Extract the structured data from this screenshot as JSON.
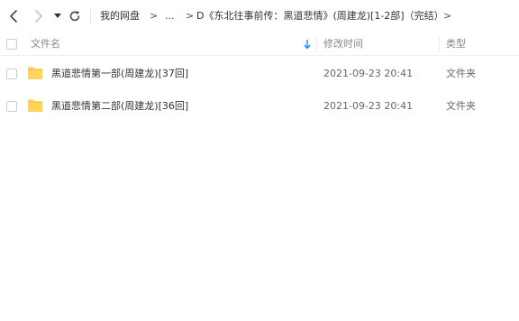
{
  "toolbar": {
    "back_icon": "chevron-left-icon",
    "forward_icon": "chevron-right-icon",
    "history_icon": "caret-down-icon",
    "refresh_icon": "refresh-icon"
  },
  "breadcrumb": {
    "home": "我的网盘",
    "separator": ">",
    "ellipsis": "...",
    "current": "D《东北往事前传：黑道悲情》(周建龙)[1-2部]（完结）"
  },
  "columns": {
    "name": "文件名",
    "date": "修改时间",
    "type": "类型",
    "sort_icon": "sort-down-arrow-icon",
    "sort_color": "#1a8cff"
  },
  "rows": [
    {
      "name": "黑道悲情第一部(周建龙)[37回]",
      "date": "2021-09-23 20:41",
      "type": "文件夹",
      "icon": "folder-icon"
    },
    {
      "name": "黑道悲情第二部(周建龙)[36回]",
      "date": "2021-09-23 20:41",
      "type": "文件夹",
      "icon": "folder-icon"
    }
  ],
  "colors": {
    "folder": "#ffc83d",
    "text": "#333333",
    "muted": "#888888",
    "border": "#c8ccd2"
  }
}
